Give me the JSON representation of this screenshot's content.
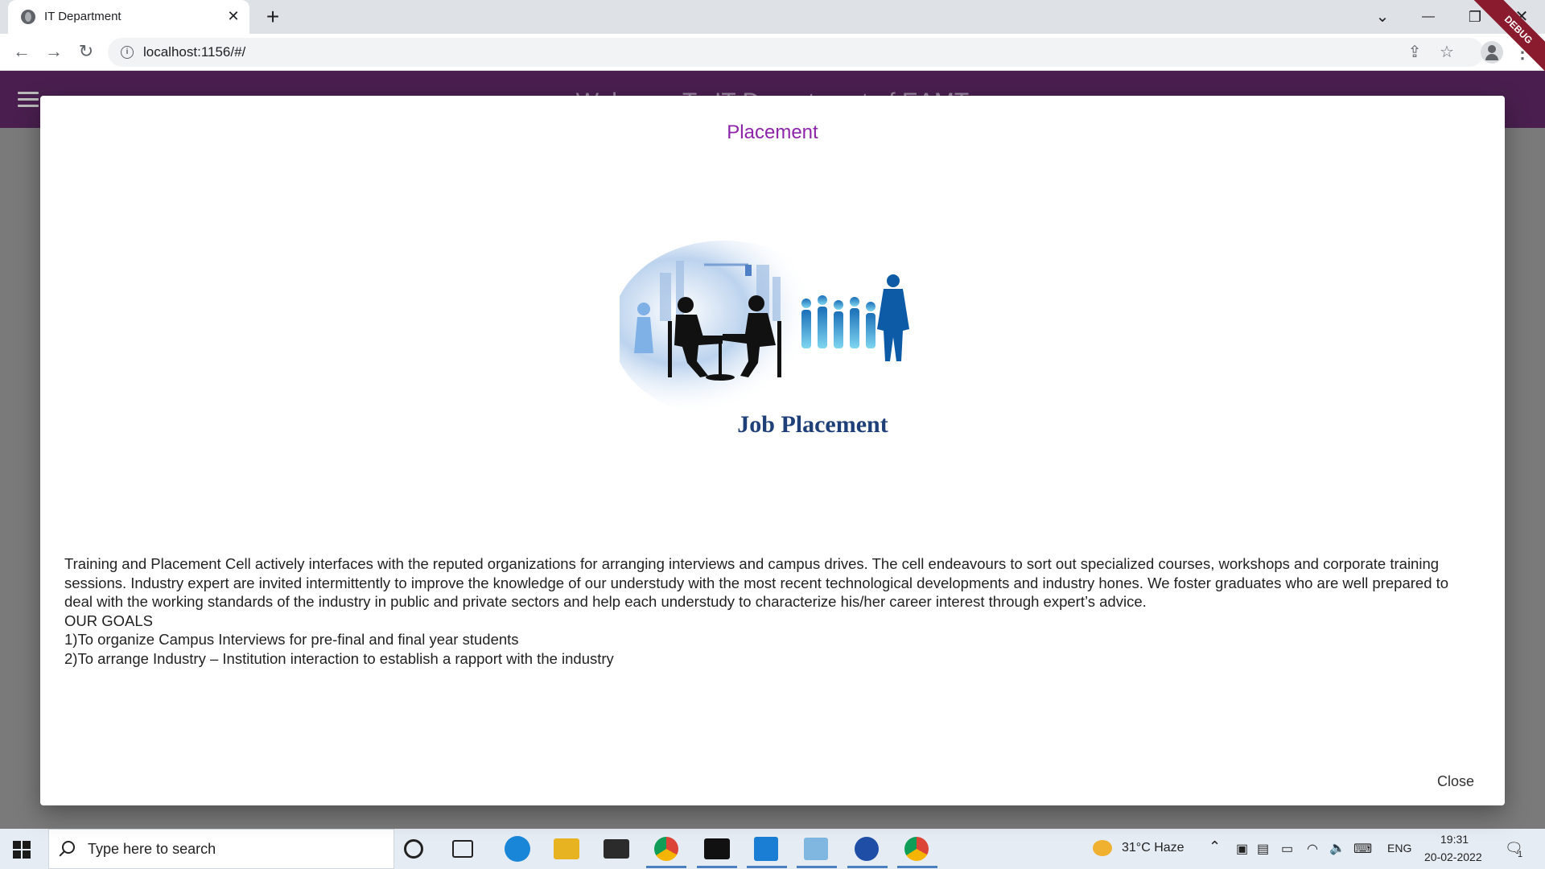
{
  "browser": {
    "tab_title": "IT Department",
    "tab_close": "✕",
    "new_tab": "+",
    "url": "localhost:1156/#/",
    "back": "←",
    "forward": "→",
    "reload": "↻",
    "share_icon": "⇪",
    "star_icon": "☆",
    "menu": "⋮",
    "minimize": "—",
    "maximize": "❐",
    "close": "✕",
    "dropdown": "⌄"
  },
  "appbar": {
    "title": "Welcome To IT Department of EAMT",
    "debug_label": "DEBUG"
  },
  "dialog": {
    "title": "Placement",
    "image_caption": "Job Placement",
    "paragraph": "Training and Placement Cell actively interfaces with the reputed organizations for arranging interviews and campus drives. The cell endeavours to sort out specialized courses, workshops and corporate training sessions. Industry expert are invited intermittently to improve the knowledge of our understudy with the most recent technological developments and industry hones. We foster graduates who are well prepared to deal with the working standards of the industry in public and private sectors and help each understudy to characterize his/her career interest through expert’s advice.",
    "goals_heading": "OUR GOALS",
    "goal_1": "1)To organize Campus Interviews for pre-final and final year students",
    "goal_2": "2)To arrange Industry – Institution interaction to establish a rapport with the industry",
    "close_label": "Close"
  },
  "taskbar": {
    "search_placeholder": "Type here to search",
    "weather": "31°C  Haze",
    "language": "ENG",
    "time": "19:31",
    "date": "20-02-2022",
    "notification_count": "1"
  }
}
